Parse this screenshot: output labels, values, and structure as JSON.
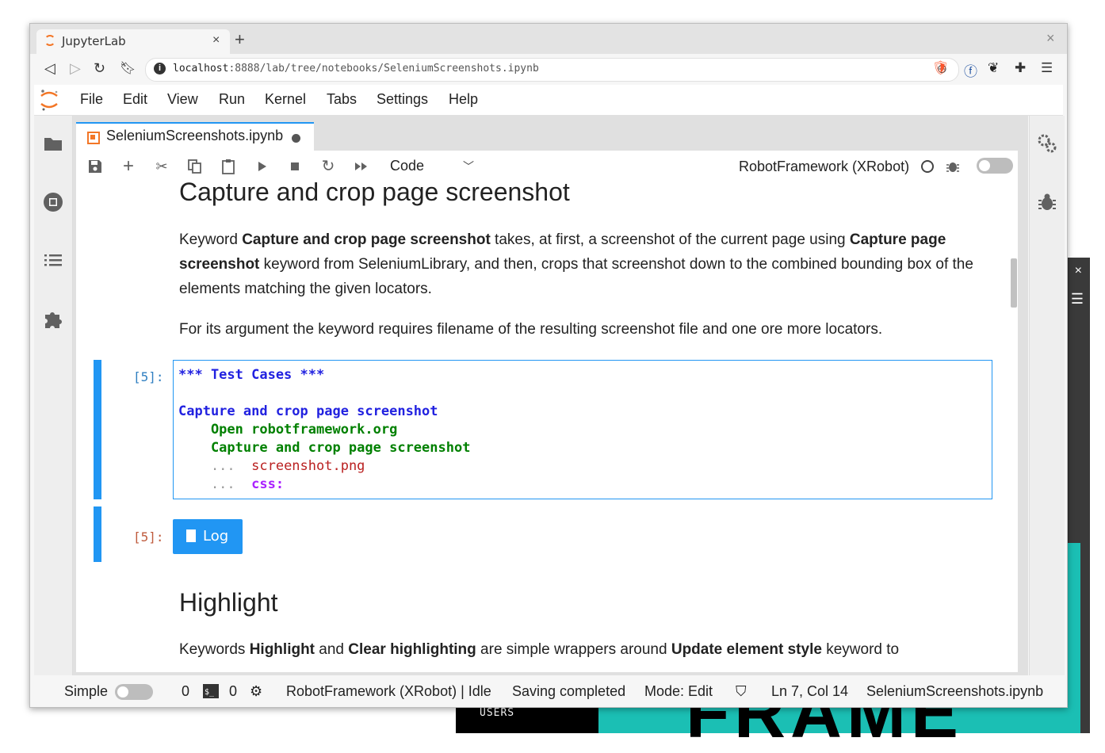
{
  "browser": {
    "tab_title": "JupyterLab",
    "tab_close": "×",
    "new_tab": "+",
    "window_close": "×",
    "url_host": "localhost",
    "url_rest": ":8888/lab/tree/notebooks/SeleniumScreenshots.ipynb"
  },
  "menu": {
    "items": [
      "File",
      "Edit",
      "View",
      "Run",
      "Kernel",
      "Tabs",
      "Settings",
      "Help"
    ]
  },
  "doc_tab": {
    "title": "SeleniumScreenshots.ipynb"
  },
  "toolbar": {
    "cell_type": "Code",
    "kernel": "RobotFramework (XRobot)"
  },
  "notebook": {
    "heading1": "Capture and crop page screenshot",
    "para1_parts": [
      "Keyword ",
      "Capture and crop page screenshot",
      " takes, at first, a screenshot of the current page using ",
      "Capture page screenshot",
      " keyword from SeleniumLibrary, and then, crops that screenshot down to the combined bounding box of the elements matching the given locators."
    ],
    "para2": "For its argument the keyword requires filename of the resulting screenshot file and one ore more locators.",
    "cell_in_prompt": "[5]:",
    "cell_out_prompt": "[5]:",
    "code_lines": {
      "l1": "*** Test Cases ***",
      "l3": "Capture and crop page screenshot",
      "l4": "    Open robotframework.org",
      "l5": "    Capture and crop page screenshot",
      "l6_dots": "    ...  ",
      "l6_val": "screenshot.png",
      "l7_dots": "    ...  ",
      "l7_val": "css:"
    },
    "log_button": "Log",
    "heading2": "Highlight",
    "para3_parts": [
      "Keywords ",
      "Highlight",
      " and ",
      "Clear highlighting",
      " are simple wrappers around ",
      "Update element style",
      " keyword to"
    ]
  },
  "status": {
    "simple_label": "Simple",
    "terminals": "0",
    "kernels": "0",
    "kernel_state": "RobotFramework (XRobot) | Idle",
    "save_state": "Saving completed",
    "mode": "Mode: Edit",
    "cursor": "Ln 7, Col 14",
    "file": "SeleniumScreenshots.ipynb"
  },
  "background_window": {
    "users_label": "USERS",
    "big_text": "FRAME"
  },
  "colors": {
    "accent": "#2196f3",
    "jupyter_orange": "#f37626",
    "code_keyword": "#2121e0",
    "code_green": "#008000",
    "code_string": "#ba2121",
    "code_purple": "#aa22ff",
    "teal": "#1bbfb4"
  }
}
